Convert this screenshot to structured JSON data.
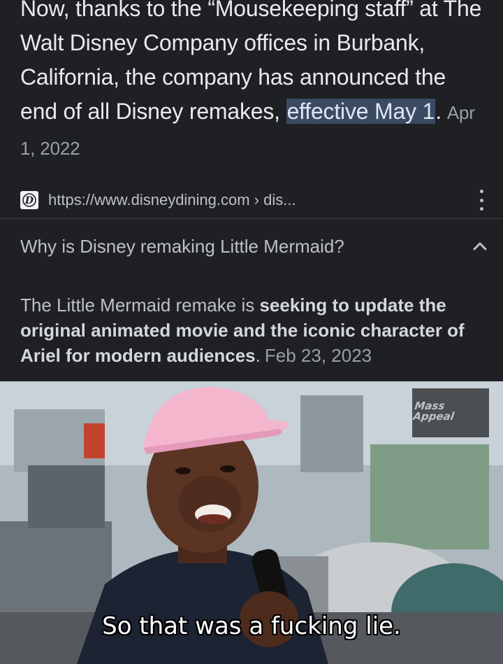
{
  "snippet": {
    "text_before": "Now, thanks to the “Mousekeeping staff” at The Walt Disney Company offices in Burbank, California, the company has announced the end of all Disney remakes, ",
    "highlight": "effective May 1",
    "text_after": ".",
    "date": "Apr 1, 2022"
  },
  "source": {
    "favicon": "D",
    "url": "https://www.disneydining.com › dis...",
    "menu_icon": "more-vertical-icon"
  },
  "question": {
    "text": "Why is Disney remaking Little Mermaid?",
    "toggle_icon": "chevron-up-icon"
  },
  "answer": {
    "lead": "The Little Mermaid remake is ",
    "bold": "seeking to update the original animated movie and the iconic character of Ariel for modern audiences",
    "tail": ".",
    "date": "Feb 23, 2023"
  },
  "meme": {
    "caption": "So that was a fucking lie.",
    "watermark": "Mass Appeal"
  },
  "colors": {
    "background": "#1f2024",
    "text_primary": "#e8eaed",
    "text_secondary": "#bdc1c6",
    "highlight_bg": "#3b4a63",
    "hat_pink": "#f4b6cd"
  }
}
